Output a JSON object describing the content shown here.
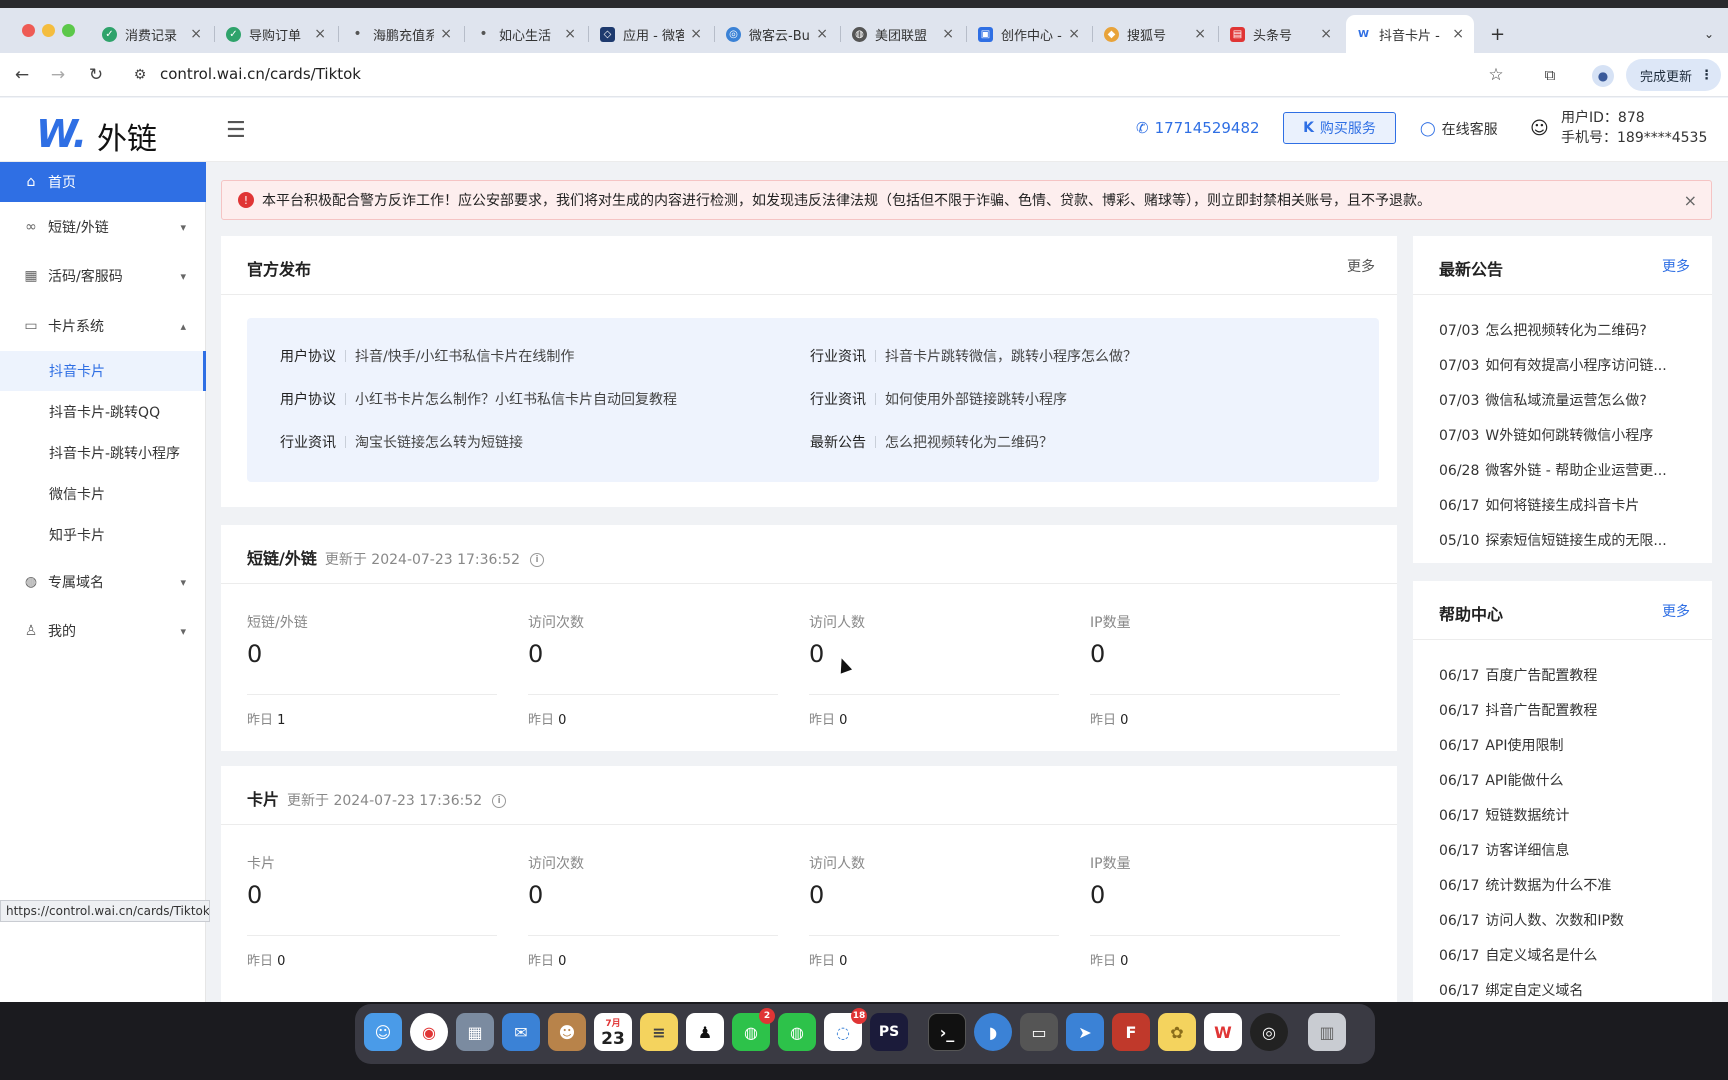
{
  "browser": {
    "tabs": [
      {
        "title": "消费记录",
        "color": "#2fa36b"
      },
      {
        "title": "导购订单",
        "color": "#2fa36b"
      },
      {
        "title": "海鹏充值系统",
        "color": "#555555"
      },
      {
        "title": "如心生活",
        "color": "#555555"
      },
      {
        "title": "应用 - 微客",
        "color": "#1e3a6e"
      },
      {
        "title": "微客云-Bug",
        "color": "#3b82d6"
      },
      {
        "title": "美团联盟",
        "color": "#555555"
      },
      {
        "title": "创作中心 - ",
        "color": "#2f6fe4"
      },
      {
        "title": "搜狐号",
        "color": "#e8a33a"
      },
      {
        "title": "头条号",
        "color": "#e03535"
      },
      {
        "title": "抖音卡片 - ",
        "color": "#2f6fe4"
      }
    ],
    "new_tab": "+",
    "url": "control.wai.cn/cards/Tiktok",
    "update_button": "完成更新",
    "status_url": "https://control.wai.cn/cards/Tiktok"
  },
  "header": {
    "logo_mark": "W.",
    "logo_text": "外链",
    "phone": "17714529482",
    "buy_button": "购买服务",
    "online_service": "在线客服",
    "user_id": "用户ID：878",
    "user_phone": "手机号：189****4535"
  },
  "sidebar": {
    "home": "首页",
    "short_link": "短链/外链",
    "live_code": "活码/客服码",
    "card_system": "卡片系统",
    "sub_items": [
      "抖音卡片",
      "抖音卡片-跳转QQ",
      "抖音卡片-跳转小程序",
      "微信卡片",
      "知乎卡片"
    ],
    "domain": "专属域名",
    "mine": "我的"
  },
  "alert": {
    "text": "本平台积极配合警方反诈工作！应公安部要求，我们将对生成的内容进行检测，如发现违反法律法规（包括但不限于诈骗、色情、贷款、博彩、赌球等），则立即封禁相关账号，且不予退款。"
  },
  "official": {
    "title": "官方发布",
    "more": "更多",
    "items": [
      {
        "cat": "用户协议",
        "text": "抖音/快手/小红书私信卡片在线制作"
      },
      {
        "cat": "行业资讯",
        "text": "抖音卡片跳转微信，跳转小程序怎么做？"
      },
      {
        "cat": "用户协议",
        "text": "小红书卡片怎么制作？小红书私信卡片自动回复教程"
      },
      {
        "cat": "行业资讯",
        "text": "如何使用外部链接跳转小程序"
      },
      {
        "cat": "行业资讯",
        "text": "淘宝长链接怎么转为短链接"
      },
      {
        "cat": "最新公告",
        "text": "怎么把视频转化为二维码？"
      }
    ]
  },
  "shortlink_stats": {
    "title": "短链/外链",
    "updated": "更新于 2024-07-23 17:36:52",
    "stats": [
      {
        "label": "短链/外链",
        "value": "0",
        "yesterday_label": "昨日",
        "yesterday": "1"
      },
      {
        "label": "访问次数",
        "value": "0",
        "yesterday_label": "昨日",
        "yesterday": "0"
      },
      {
        "label": "访问人数",
        "value": "0",
        "yesterday_label": "昨日",
        "yesterday": "0"
      },
      {
        "label": "IP数量",
        "value": "0",
        "yesterday_label": "昨日",
        "yesterday": "0"
      }
    ]
  },
  "card_stats": {
    "title": "卡片",
    "updated": "更新于 2024-07-23 17:36:52",
    "stats": [
      {
        "label": "卡片",
        "value": "0",
        "yesterday_label": "昨日",
        "yesterday": "0"
      },
      {
        "label": "访问次数",
        "value": "0",
        "yesterday_label": "昨日",
        "yesterday": "0"
      },
      {
        "label": "访问人数",
        "value": "0",
        "yesterday_label": "昨日",
        "yesterday": "0"
      },
      {
        "label": "IP数量",
        "value": "0",
        "yesterday_label": "昨日",
        "yesterday": "0"
      }
    ]
  },
  "announcements": {
    "title": "最新公告",
    "more": "更多",
    "items": [
      {
        "date": "07/03",
        "text": "怎么把视频转化为二维码?"
      },
      {
        "date": "07/03",
        "text": "如何有效提高小程序访问链..."
      },
      {
        "date": "07/03",
        "text": "微信私域流量运营怎么做?"
      },
      {
        "date": "07/03",
        "text": "W外链如何跳转微信小程序"
      },
      {
        "date": "06/28",
        "text": "微客外链 - 帮助企业运营更..."
      },
      {
        "date": "06/17",
        "text": "如何将链接生成抖音卡片"
      },
      {
        "date": "05/10",
        "text": "探索短信短链接生成的无限..."
      }
    ]
  },
  "help": {
    "title": "帮助中心",
    "more": "更多",
    "items": [
      {
        "date": "06/17",
        "text": "百度广告配置教程"
      },
      {
        "date": "06/17",
        "text": "抖音广告配置教程"
      },
      {
        "date": "06/17",
        "text": "API使用限制"
      },
      {
        "date": "06/17",
        "text": "API能做什么"
      },
      {
        "date": "06/17",
        "text": "短链数据统计"
      },
      {
        "date": "06/17",
        "text": "访客详细信息"
      },
      {
        "date": "06/17",
        "text": "统计数据为什么不准"
      },
      {
        "date": "06/17",
        "text": "访问人数、次数和IP数"
      },
      {
        "date": "06/17",
        "text": "自定义域名是什么"
      },
      {
        "date": "06/17",
        "text": "绑定自定义域名"
      }
    ]
  },
  "dock": {
    "calendar_month": "7月",
    "calendar_day": "23",
    "wechat_badge": "2",
    "qq_badge": "18",
    "ps_label": "PS",
    "wps_label": "W"
  }
}
